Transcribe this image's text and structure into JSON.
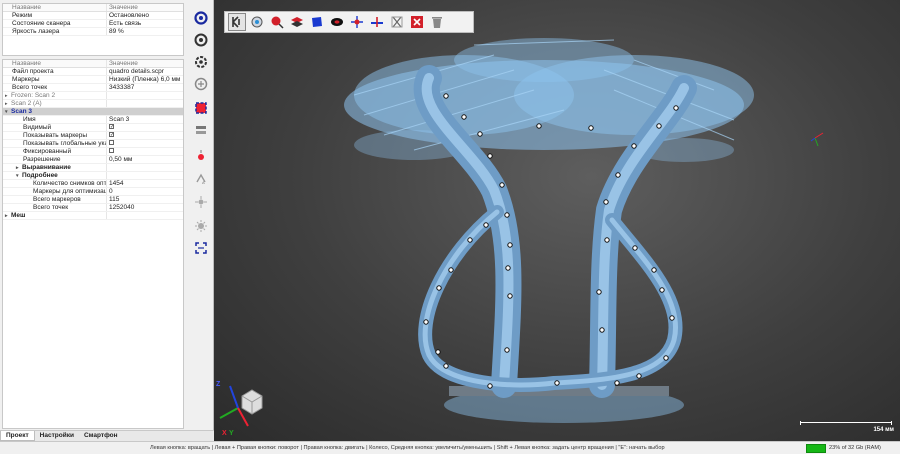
{
  "props1": {
    "header": {
      "name": "Название",
      "value": "Значение"
    },
    "rows": [
      {
        "name": "Режим",
        "value": "Остановлено"
      },
      {
        "name": "Состояние сканера",
        "value": "Есть связь"
      },
      {
        "name": "Яркость лазера",
        "value": "89 %"
      }
    ]
  },
  "props2": {
    "header": {
      "name": "Название",
      "value": "Значение"
    },
    "project_file": {
      "name": "Файл проекта",
      "value": "quadro details.scpr"
    },
    "markers": {
      "name": "Маркеры",
      "value": "Низкий (Пленка) 6,0 мм"
    },
    "total_points": {
      "name": "Всего точек",
      "value": "3433387"
    },
    "frozen_scan2": "Frozen: Scan 2",
    "scan2": "Scan 2 (A)",
    "scan3": "Scan 3",
    "s3": {
      "name": {
        "name": "Имя",
        "value": "Scan 3"
      },
      "visible": {
        "name": "Видимый",
        "checked": true
      },
      "show_markers": {
        "name": "Показывать маркеры",
        "checked": true
      },
      "show_global": {
        "name": "Показывать глобальные указ...",
        "checked": false
      },
      "fixed": {
        "name": "Фиксированный",
        "checked": false
      },
      "resolution": {
        "name": "Разрешение",
        "value": "0,50 мм"
      },
      "alignment": "Выравнивание",
      "details": "Подробнее",
      "shots": {
        "name": "Количество снимков опт...",
        "value": "1454"
      },
      "opt_markers": {
        "name": "Маркеры для оптимизации",
        "value": "0"
      },
      "total_markers": {
        "name": "Всего маркеров",
        "value": "115"
      },
      "total_points": {
        "name": "Всего точек",
        "value": "1252040"
      }
    },
    "mesh": "Меш"
  },
  "tabs": [
    "Проект",
    "Настройки",
    "Смартфон"
  ],
  "viewport": {
    "scale_label": "154 мм",
    "axis_labels": {
      "x": "X",
      "y": "Y",
      "z": "Z"
    }
  },
  "status": {
    "hint": "Левая кнопка: вращать  |  Левая + Правая кнопки: поворот  |  Правая кнопка: двигать  |  Колесо, Средняя кнопка: увеличить/уменьшить  |  Shift + Левая кнопка: задать центр вращения  |  \"E\": начать выбор",
    "memory": "23% of 32 Gb (RAM)",
    "memory_fraction": 0.23
  },
  "icons": [
    "tool-snap-icon",
    "tool-target-icon",
    "tool-lasso-icon",
    "tool-layers-icon",
    "tool-plane-icon",
    "tool-ellipse-icon",
    "tool-wand-icon",
    "tool-brush-icon",
    "tool-cut-icon",
    "tool-erase-icon",
    "tool-delete-icon"
  ],
  "colors": {
    "point_cloud": "#8ec3ee",
    "model": "#8ab9e0",
    "accent": "#1a2aa0",
    "memory_bar": "#16b716"
  }
}
